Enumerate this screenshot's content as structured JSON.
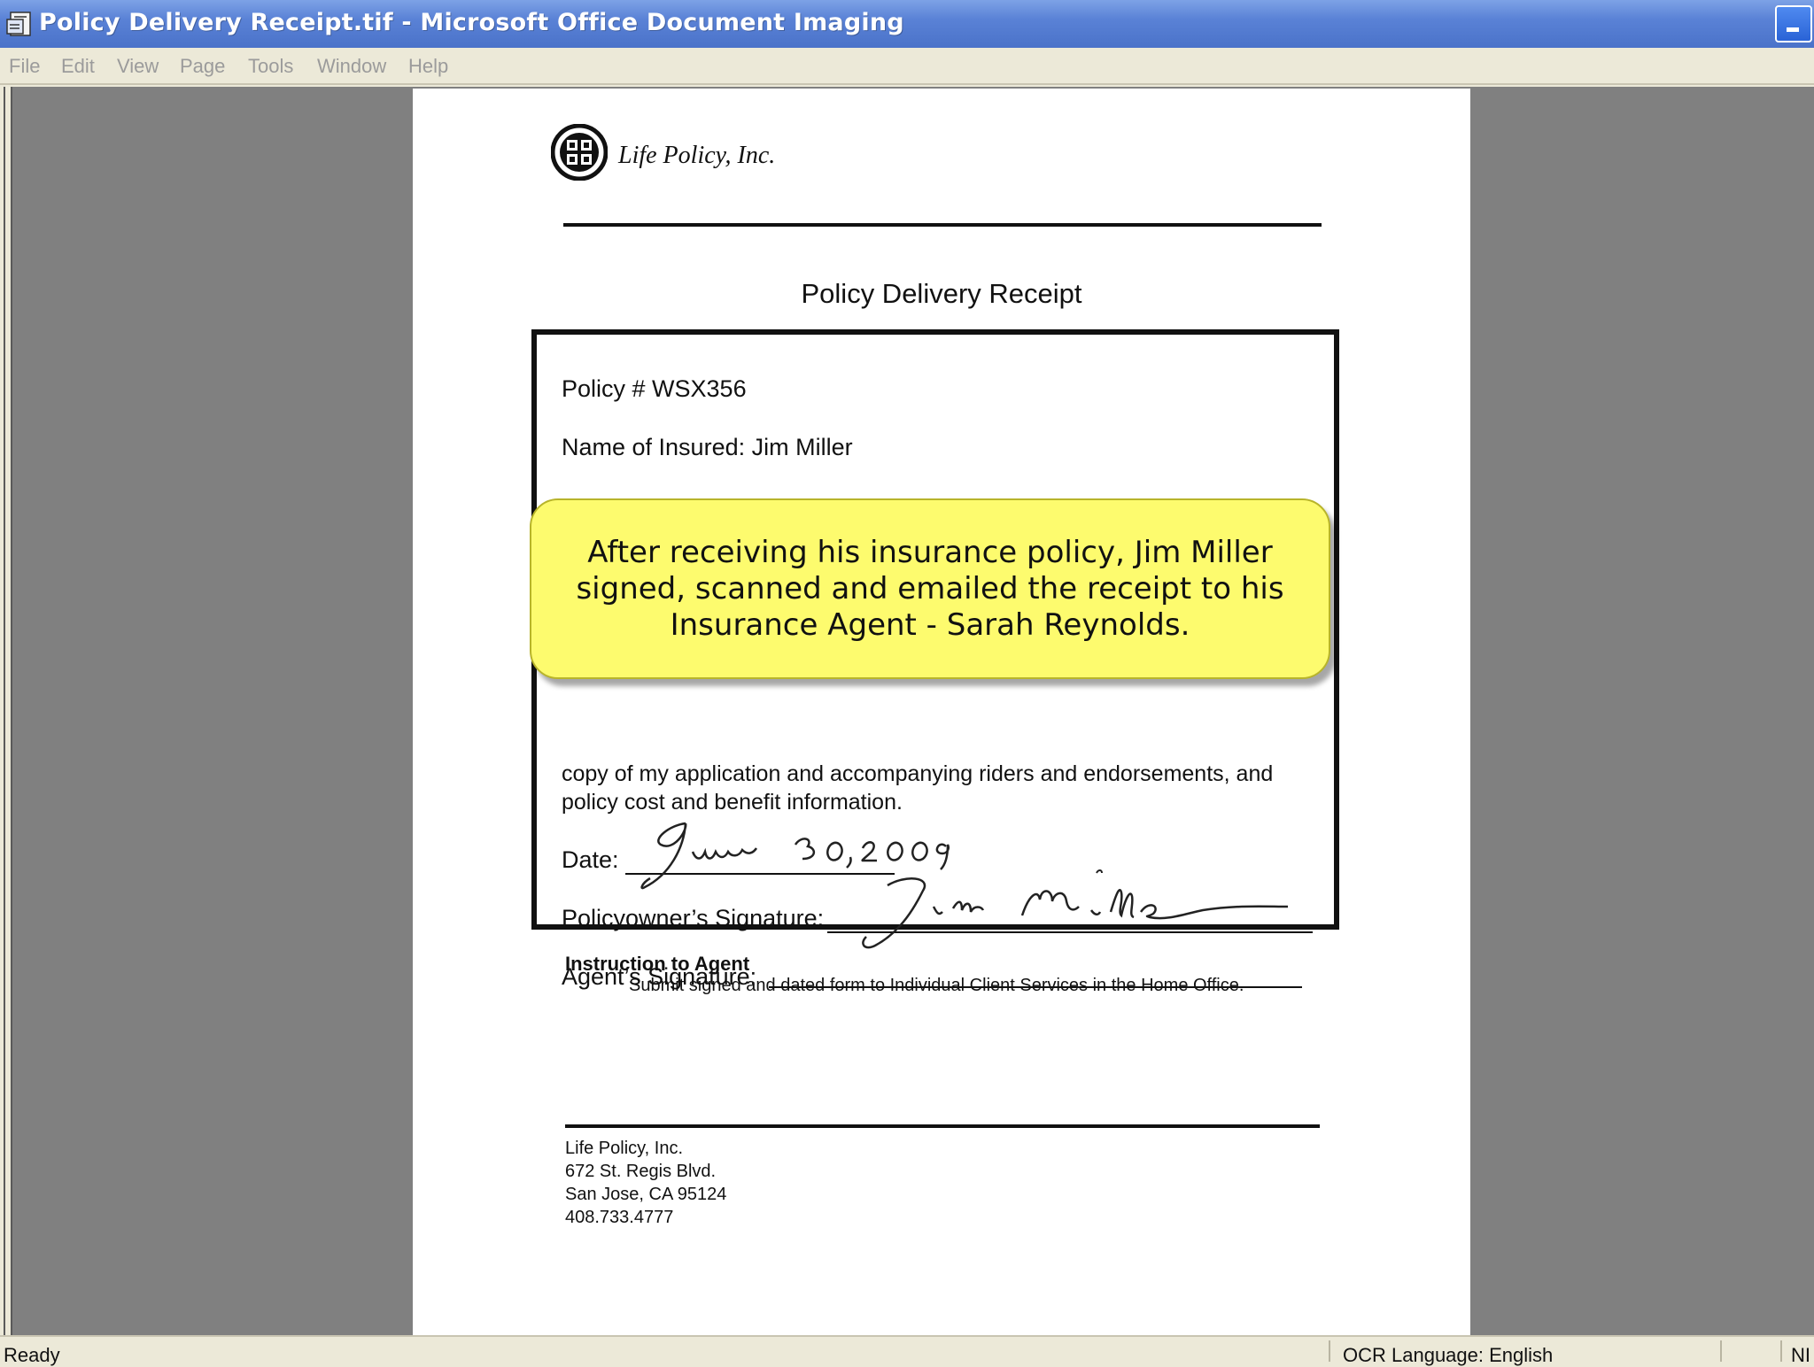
{
  "window": {
    "title": "Policy Delivery Receipt.tif - Microsoft Office Document Imaging",
    "app_icon": "document-imaging-icon",
    "minimize_icon": "minimize-icon"
  },
  "menu": {
    "items": [
      "File",
      "Edit",
      "View",
      "Page",
      "Tools",
      "Window",
      "Help"
    ]
  },
  "document": {
    "company_name": "Life Policy, Inc.",
    "title": "Policy Delivery Receipt",
    "policy_number": "Policy # WSX356",
    "insured_name": "Name of Insured:  Jim Miller",
    "body_text": "copy of my application and accompanying riders and endorsements, and policy cost and benefit information.",
    "date_label": "Date:",
    "date_value": "June 30, 2009",
    "policyowner_signature_label": "Policyowner’s Signature:",
    "policyowner_signature_value": "Jim Miller",
    "agent_signature_label": "Agent’s Signature:",
    "instruction_heading": "Instruction to Agent",
    "instruction_text": "Submit signed and dated form to Individual Client Services in the Home Office.",
    "address": [
      "Life Policy, Inc.",
      "672 St. Regis Blvd.",
      "San Jose, CA  95124",
      "408.733.4777"
    ]
  },
  "callout": {
    "text": "After receiving his insurance policy, Jim Miller signed, scanned and emailed the receipt to his Insurance Agent - Sarah Reynolds."
  },
  "status": {
    "left": "Ready",
    "ocr": "OCR Language: English",
    "right": "NI"
  },
  "colors": {
    "titlebar": "#5a82d6",
    "callout": "#fdfb6e",
    "workspace": "#808080"
  }
}
